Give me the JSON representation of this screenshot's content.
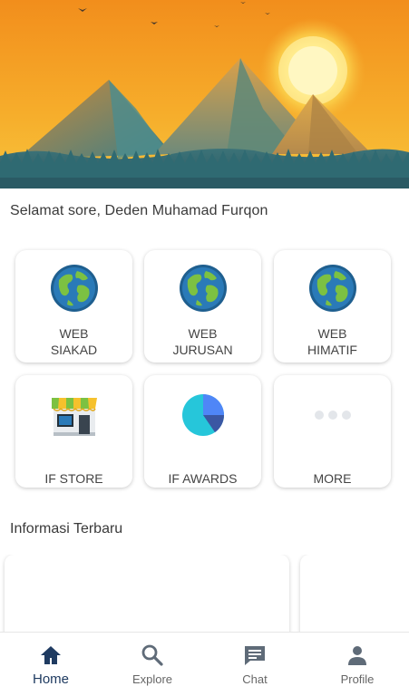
{
  "greeting": "Selamat sore, Deden Muhamad Furqon",
  "menu": [
    {
      "line1": "WEB",
      "line2": "SIAKAD",
      "icon": "globe-icon"
    },
    {
      "line1": "WEB",
      "line2": "JURUSAN",
      "icon": "globe-icon"
    },
    {
      "line1": "WEB",
      "line2": "HIMATIF",
      "icon": "globe-icon"
    },
    {
      "line1": "IF STORE",
      "icon": "store-icon"
    },
    {
      "line1": "IF AWARDS",
      "icon": "pie-chart-icon"
    },
    {
      "line1": "MORE",
      "icon": "more-dots-icon"
    }
  ],
  "info_title": "Informasi Terbaru",
  "bottom_nav": [
    {
      "label": "Home",
      "icon": "home-icon",
      "active": true
    },
    {
      "label": "Explore",
      "icon": "search-icon",
      "active": false
    },
    {
      "label": "Chat",
      "icon": "chat-icon",
      "active": false
    },
    {
      "label": "Profile",
      "icon": "profile-icon",
      "active": false
    }
  ],
  "colors": {
    "nav_active": "#1f3b61",
    "nav_inactive": "#666666",
    "sky_top": "#f39a1f",
    "sky_bottom": "#f8c23a",
    "globe_ocean": "#2a7ab8",
    "globe_land": "#7cc142"
  }
}
